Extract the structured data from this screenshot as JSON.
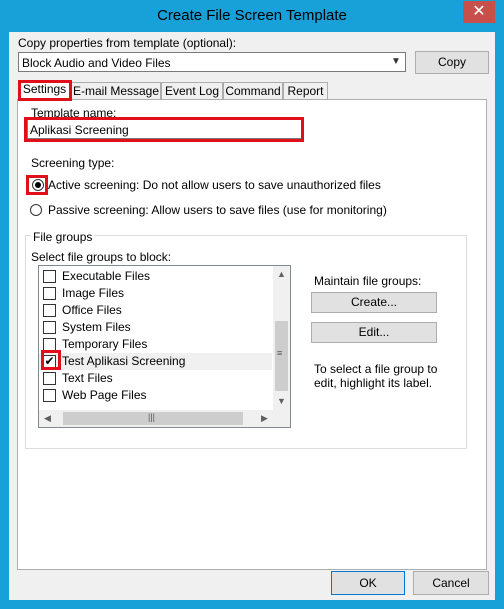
{
  "window": {
    "title": "Create File Screen Template",
    "close_glyph": "✕"
  },
  "copy_props": {
    "label": "Copy properties from template (optional):",
    "selected": "Block Audio and Video Files",
    "copy_button": "Copy"
  },
  "tabs": [
    {
      "label": "Settings",
      "active": true
    },
    {
      "label": "E-mail Message",
      "active": false
    },
    {
      "label": "Event Log",
      "active": false
    },
    {
      "label": "Command",
      "active": false
    },
    {
      "label": "Report",
      "active": false
    }
  ],
  "settings": {
    "template_name_label": "Template name:",
    "template_name_value": "Aplikasi Screening",
    "screening_type_label": "Screening type:",
    "active_label": "Active screening: Do not allow users to save unauthorized files",
    "passive_label": "Passive screening: Allow users to save files (use for monitoring)",
    "selected_screening": "active"
  },
  "file_groups": {
    "group_label": "File groups",
    "select_label": "Select file groups to block:",
    "items": [
      {
        "label": "Executable Files",
        "checked": false
      },
      {
        "label": "Image Files",
        "checked": false
      },
      {
        "label": "Office Files",
        "checked": false
      },
      {
        "label": "System Files",
        "checked": false
      },
      {
        "label": "Temporary Files",
        "checked": false
      },
      {
        "label": "Test Aplikasi Screening",
        "checked": true
      },
      {
        "label": "Text Files",
        "checked": false
      },
      {
        "label": "Web Page Files",
        "checked": false
      }
    ],
    "selected_index": 5,
    "maintain_label": "Maintain file groups:",
    "create_button": "Create...",
    "edit_button": "Edit...",
    "hint": "To select a file group to edit, highlight its label."
  },
  "buttons": {
    "ok": "OK",
    "cancel": "Cancel"
  },
  "colors": {
    "title_bar": "#18a0d8",
    "highlight_red": "#e0101a",
    "close_red": "#c7504a"
  }
}
